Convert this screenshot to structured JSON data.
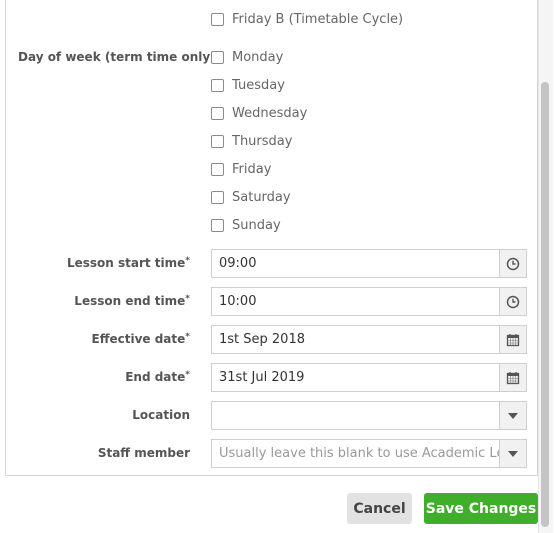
{
  "week_cycle": {
    "options": [
      {
        "label": "Friday B (Timetable Cycle)",
        "checked": false
      }
    ]
  },
  "day_of_week": {
    "label": "Day of week (term time only)",
    "options": [
      {
        "label": "Monday",
        "checked": false
      },
      {
        "label": "Tuesday",
        "checked": false
      },
      {
        "label": "Wednesday",
        "checked": false
      },
      {
        "label": "Thursday",
        "checked": false
      },
      {
        "label": "Friday",
        "checked": false
      },
      {
        "label": "Saturday",
        "checked": false
      },
      {
        "label": "Sunday",
        "checked": false
      }
    ]
  },
  "fields": {
    "lesson_start_time": {
      "label": "Lesson start time",
      "required_mark": "*",
      "value": "09:00",
      "icon": "clock-icon"
    },
    "lesson_end_time": {
      "label": "Lesson end time",
      "required_mark": "*",
      "value": "10:00",
      "icon": "clock-icon"
    },
    "effective_date": {
      "label": "Effective date",
      "required_mark": "*",
      "value": "1st Sep 2018",
      "icon": "calendar-icon"
    },
    "end_date": {
      "label": "End date",
      "required_mark": "*",
      "value": "31st Jul 2019",
      "icon": "calendar-icon"
    },
    "location": {
      "label": "Location",
      "value": "",
      "icon": "chevron-down-icon"
    },
    "staff_member": {
      "label": "Staff member",
      "placeholder": "Usually leave this blank to use Academic Leads",
      "value": "",
      "icon": "chevron-down-icon"
    }
  },
  "buttons": {
    "cancel": "Cancel",
    "save": "Save Changes"
  },
  "colors": {
    "primary": "#3fae2a",
    "border": "#cfcfcf"
  }
}
